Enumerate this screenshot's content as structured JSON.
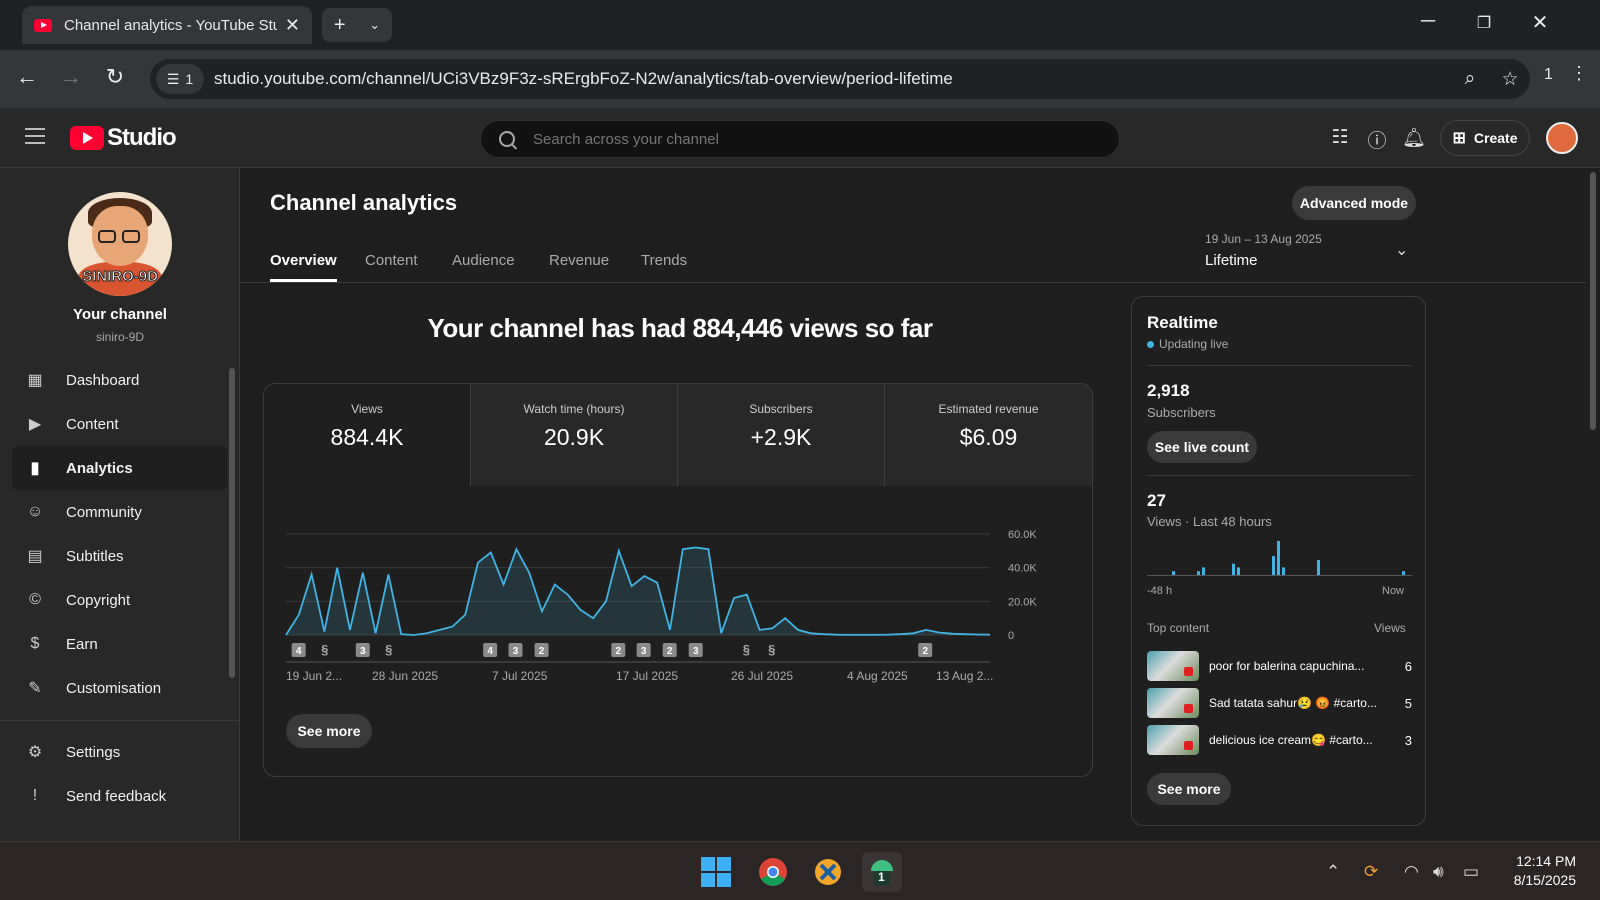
{
  "browser": {
    "tab_title": "Channel analytics - YouTube Studio",
    "site_badge": "1",
    "url": "studio.youtube.com/channel/UCi3VBz9F3z-sRErgbFoZ-N2w/analytics/tab-overview/period-lifetime",
    "extension_count": "1"
  },
  "studio": {
    "logo_text": "Studio",
    "search_placeholder": "Search across your channel",
    "create_label": "Create"
  },
  "sidebar": {
    "avatar_name": "SINIRO-9D",
    "your_channel": "Your channel",
    "handle": "siniro-9D",
    "items": [
      {
        "label": "Dashboard",
        "icon": "dashboard-icon"
      },
      {
        "label": "Content",
        "icon": "content-icon"
      },
      {
        "label": "Analytics",
        "icon": "analytics-icon"
      },
      {
        "label": "Community",
        "icon": "community-icon"
      },
      {
        "label": "Subtitles",
        "icon": "subtitles-icon"
      },
      {
        "label": "Copyright",
        "icon": "copyright-icon"
      },
      {
        "label": "Earn",
        "icon": "earn-icon"
      },
      {
        "label": "Customisation",
        "icon": "customisation-icon"
      }
    ],
    "bottom_items": [
      {
        "label": "Settings",
        "icon": "settings-icon"
      },
      {
        "label": "Send feedback",
        "icon": "feedback-icon"
      }
    ]
  },
  "main": {
    "title": "Channel analytics",
    "advanced_mode": "Advanced mode",
    "tabs": [
      "Overview",
      "Content",
      "Audience",
      "Revenue",
      "Trends"
    ],
    "period_dates": "19 Jun – 13 Aug 2025",
    "period_label": "Lifetime",
    "headline": "Your channel has had 884,446 views so far",
    "metrics": [
      {
        "label": "Views",
        "value": "884.4K"
      },
      {
        "label": "Watch time (hours)",
        "value": "20.9K"
      },
      {
        "label": "Subscribers",
        "value": "+2.9K"
      },
      {
        "label": "Estimated revenue",
        "value": "$6.09"
      }
    ],
    "see_more": "See more"
  },
  "chart_data": {
    "type": "area",
    "y_ticks": [
      "60.0K",
      "40.0K",
      "20.0K",
      "0"
    ],
    "ylim": [
      0,
      60000
    ],
    "x_labels": [
      "19 Jun 2...",
      "28 Jun 2025",
      "7 Jul 2025",
      "17 Jul 2025",
      "26 Jul 2025",
      "4 Aug 2025",
      "13 Aug 2..."
    ],
    "values": [
      0,
      12000,
      36000,
      2000,
      40000,
      3000,
      37000,
      1000,
      36000,
      500,
      0,
      1000,
      3000,
      5000,
      12000,
      43000,
      49000,
      30000,
      51000,
      37000,
      14000,
      30000,
      24000,
      15000,
      10000,
      20000,
      50000,
      29000,
      35000,
      31000,
      3000,
      51000,
      52000,
      51000,
      1000,
      22000,
      24000,
      3000,
      4000,
      10000,
      3000,
      1000,
      500,
      200,
      100,
      100,
      100,
      200,
      500,
      1000,
      3000,
      1500,
      800,
      500,
      300,
      200
    ],
    "markers": [
      "4",
      "shorts",
      "3",
      "shorts",
      "4",
      "3",
      "2",
      "2",
      "3",
      "2",
      "3",
      "shorts",
      "shorts",
      "2"
    ],
    "grid": true,
    "color": "#41b4e6"
  },
  "realtime": {
    "title": "Realtime",
    "status": "Updating live",
    "subscribers_value": "2,918",
    "subscribers_label": "Subscribers",
    "live_count_button": "See live count",
    "views_value": "27",
    "views_label": "Views · Last 48 hours",
    "bars": [
      0,
      0,
      0,
      0,
      0,
      1,
      0,
      0,
      0,
      0,
      1,
      2,
      0,
      0,
      0,
      0,
      0,
      3,
      2,
      0,
      0,
      0,
      0,
      0,
      0,
      5,
      9,
      2,
      0,
      0,
      0,
      0,
      0,
      0,
      4,
      0,
      0,
      0,
      0,
      0,
      0,
      0,
      0,
      0,
      0,
      0,
      0,
      0,
      0,
      0,
      0,
      1,
      0
    ],
    "axis_start": "-48 h",
    "axis_end": "Now",
    "top_content_label": "Top content",
    "top_views_label": "Views",
    "top_content": [
      {
        "title": "poor for balerina capuchina...",
        "views": "6"
      },
      {
        "title": "Sad tatata sahur😢 😡 #carto...",
        "views": "5"
      },
      {
        "title": "delicious ice cream😋 #carto...",
        "views": "3"
      }
    ],
    "see_more": "See more"
  },
  "taskbar": {
    "time": "12:14 PM",
    "date": "8/15/2025",
    "badge": "1"
  }
}
